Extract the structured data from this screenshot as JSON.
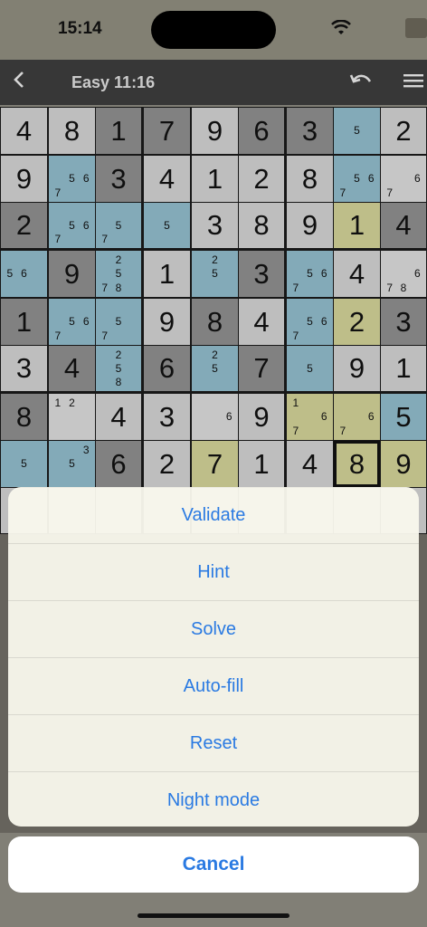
{
  "status": {
    "time": "15:14"
  },
  "toolbar": {
    "back_icon": "chevron-left-icon",
    "title": "Easy  11:16",
    "undo_icon": "undo-icon",
    "menu_icon": "hamburger-menu-icon"
  },
  "board": {
    "cells": [
      [
        {
          "v": "4",
          "c": "white"
        },
        {
          "v": "8",
          "c": "white"
        },
        {
          "v": "1",
          "c": "grey"
        },
        {
          "v": "7",
          "c": "grey"
        },
        {
          "v": "9",
          "c": "white"
        },
        {
          "v": "6",
          "c": "grey"
        },
        {
          "v": "3",
          "c": "grey"
        },
        {
          "n": [
            "",
            "",
            "",
            "",
            "5",
            "",
            "",
            "",
            ""
          ],
          "c": "blue"
        },
        {
          "v": "2",
          "c": "white"
        }
      ],
      [
        {
          "v": "9",
          "c": "white"
        },
        {
          "n": [
            "",
            "",
            "",
            "",
            "5",
            "6",
            "7",
            "",
            ""
          ],
          "c": "blue"
        },
        {
          "v": "3",
          "c": "grey"
        },
        {
          "v": "4",
          "c": "white"
        },
        {
          "v": "1",
          "c": "white"
        },
        {
          "v": "2",
          "c": "white"
        },
        {
          "v": "8",
          "c": "white"
        },
        {
          "n": [
            "",
            "",
            "",
            "",
            "5",
            "6",
            "7",
            "",
            ""
          ],
          "c": "blue"
        },
        {
          "n": [
            "",
            "",
            "",
            "",
            "",
            "6",
            "7",
            "",
            ""
          ],
          "c": "light"
        }
      ],
      [
        {
          "v": "2",
          "c": "grey"
        },
        {
          "n": [
            "",
            "",
            "",
            "",
            "5",
            "6",
            "7",
            "",
            ""
          ],
          "c": "blue"
        },
        {
          "n": [
            "",
            "",
            "",
            "",
            "5",
            "",
            "7",
            "",
            ""
          ],
          "c": "blue"
        },
        {
          "n": [
            "",
            "",
            "",
            "",
            "5",
            "",
            "",
            "",
            ""
          ],
          "c": "blue"
        },
        {
          "v": "3",
          "c": "white"
        },
        {
          "v": "8",
          "c": "white"
        },
        {
          "v": "9",
          "c": "white"
        },
        {
          "v": "1",
          "c": "yellow"
        },
        {
          "v": "4",
          "c": "grey"
        }
      ],
      [
        {
          "n": [
            "",
            "",
            "",
            "5",
            "6",
            "",
            "",
            "",
            ""
          ],
          "c": "blue"
        },
        {
          "v": "9",
          "c": "grey"
        },
        {
          "n": [
            "",
            "2",
            "",
            "",
            "5",
            "",
            "7",
            "8",
            ""
          ],
          "c": "blue"
        },
        {
          "v": "1",
          "c": "white"
        },
        {
          "n": [
            "",
            "2",
            "",
            "",
            "5",
            "",
            "",
            "",
            ""
          ],
          "c": "blue"
        },
        {
          "v": "3",
          "c": "grey"
        },
        {
          "n": [
            "",
            "",
            "",
            "",
            "5",
            "6",
            "7",
            "",
            ""
          ],
          "c": "blue"
        },
        {
          "v": "4",
          "c": "white"
        },
        {
          "n": [
            "",
            "",
            "",
            "",
            "",
            "6",
            "7",
            "8",
            ""
          ],
          "c": "light"
        }
      ],
      [
        {
          "v": "1",
          "c": "grey"
        },
        {
          "n": [
            "",
            "",
            "",
            "",
            "5",
            "6",
            "7",
            "",
            ""
          ],
          "c": "blue"
        },
        {
          "n": [
            "",
            "",
            "",
            "",
            "5",
            "",
            "7",
            "",
            ""
          ],
          "c": "blue"
        },
        {
          "v": "9",
          "c": "white"
        },
        {
          "v": "8",
          "c": "grey"
        },
        {
          "v": "4",
          "c": "white"
        },
        {
          "n": [
            "",
            "",
            "",
            "",
            "5",
            "6",
            "7",
            "",
            ""
          ],
          "c": "blue"
        },
        {
          "v": "2",
          "c": "yellow"
        },
        {
          "v": "3",
          "c": "grey"
        }
      ],
      [
        {
          "v": "3",
          "c": "white"
        },
        {
          "v": "4",
          "c": "grey"
        },
        {
          "n": [
            "",
            "2",
            "",
            "",
            "5",
            "",
            "",
            "8",
            ""
          ],
          "c": "blue"
        },
        {
          "v": "6",
          "c": "grey"
        },
        {
          "n": [
            "",
            "2",
            "",
            "",
            "5",
            "",
            "",
            "",
            ""
          ],
          "c": "blue"
        },
        {
          "v": "7",
          "c": "grey"
        },
        {
          "n": [
            "",
            "",
            "",
            "",
            "5",
            "",
            "",
            "",
            ""
          ],
          "c": "blue"
        },
        {
          "v": "9",
          "c": "white"
        },
        {
          "v": "1",
          "c": "white"
        }
      ],
      [
        {
          "v": "8",
          "c": "grey"
        },
        {
          "n": [
            "1",
            "2",
            "",
            "",
            "",
            "",
            "",
            "",
            ""
          ],
          "c": "light"
        },
        {
          "v": "4",
          "c": "white"
        },
        {
          "v": "3",
          "c": "white"
        },
        {
          "n": [
            "",
            "",
            "",
            "",
            "",
            "6",
            "",
            "",
            ""
          ],
          "c": "light"
        },
        {
          "v": "9",
          "c": "white"
        },
        {
          "n": [
            "1",
            "",
            "",
            "",
            "",
            "6",
            "7",
            "",
            ""
          ],
          "c": "yellow"
        },
        {
          "n": [
            "",
            "",
            "",
            "",
            "",
            "6",
            "7",
            "",
            ""
          ],
          "c": "yellow"
        },
        {
          "v": "5",
          "c": "blue"
        }
      ],
      [
        {
          "n": [
            "",
            "",
            "",
            "",
            "5",
            "",
            "",
            "",
            ""
          ],
          "c": "blue"
        },
        {
          "n": [
            "",
            "",
            "3",
            "",
            "5",
            "",
            "",
            "",
            ""
          ],
          "c": "blue"
        },
        {
          "v": "6",
          "c": "grey"
        },
        {
          "v": "2",
          "c": "white"
        },
        {
          "v": "7",
          "c": "yellow"
        },
        {
          "v": "1",
          "c": "white"
        },
        {
          "v": "4",
          "c": "white"
        },
        {
          "v": "8",
          "c": "sel"
        },
        {
          "v": "9",
          "c": "yellow"
        }
      ],
      [
        {
          "v": "",
          "c": "white"
        },
        {
          "v": "",
          "c": "white"
        },
        {
          "v": "",
          "c": "white"
        },
        {
          "v": "",
          "c": "white"
        },
        {
          "v": "",
          "c": "white"
        },
        {
          "v": "",
          "c": "white"
        },
        {
          "v": "",
          "c": "white"
        },
        {
          "v": "",
          "c": "white"
        },
        {
          "v": "",
          "c": "white"
        }
      ]
    ]
  },
  "action_sheet": {
    "items": [
      "Validate",
      "Hint",
      "Solve",
      "Auto-fill",
      "Reset",
      "Night mode"
    ],
    "cancel": "Cancel"
  },
  "colors": {
    "accent": "#2a7ae2",
    "toolbar_bg": "#3c3c3c"
  }
}
